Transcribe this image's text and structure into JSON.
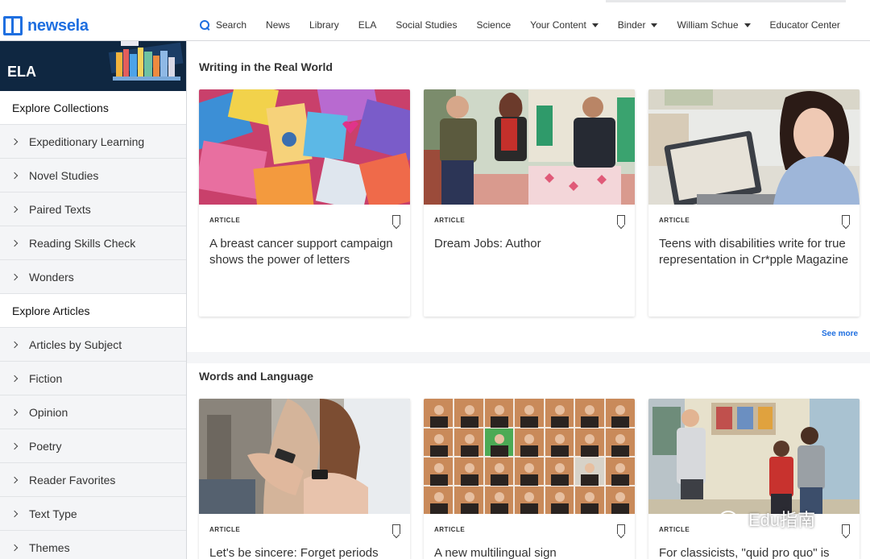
{
  "brand": {
    "name": "newsela",
    "color": "#1f6fe0"
  },
  "nav": {
    "search_label": "Search",
    "items": [
      "News",
      "Library",
      "ELA",
      "Social Studies",
      "Science"
    ],
    "your_content": "Your Content",
    "binder": "Binder",
    "user": "William Schue",
    "educator_center": "Educator Center"
  },
  "sidebar": {
    "title": "ELA",
    "collections_title": "Explore Collections",
    "collections": [
      "Expeditionary Learning",
      "Novel Studies",
      "Paired Texts",
      "Reading Skills Check",
      "Wonders"
    ],
    "articles_title": "Explore Articles",
    "articles": [
      "Articles by Subject",
      "Fiction",
      "Opinion",
      "Poetry",
      "Reader Favorites",
      "Text Type",
      "Themes"
    ]
  },
  "sections": [
    {
      "title": "Writing in the Real World",
      "cards": [
        {
          "kind": "ARTICLE",
          "title": "A breast cancer support campaign shows the power of letters",
          "image": "colorful-letters-photo"
        },
        {
          "kind": "ARTICLE",
          "title": "Dream Jobs: Author",
          "image": "author-panel-photo"
        },
        {
          "kind": "ARTICLE",
          "title": "Teens with disabilities write for true representation in Cr*pple Magazine",
          "image": "teen-laptop-photo"
        }
      ],
      "see_more": "See more"
    },
    {
      "title": "Words and Language",
      "cards": [
        {
          "kind": "ARTICLE",
          "title": "Let's be sincere: Forget periods",
          "image": "texting-teens-photo"
        },
        {
          "kind": "ARTICLE",
          "title": "A new multilingual sign",
          "image": "sign-language-grid-photo"
        },
        {
          "kind": "ARTICLE",
          "title": "For classicists, \"quid pro quo\" is",
          "image": "classroom-photo"
        }
      ]
    }
  ],
  "watermark": "Edu指南"
}
